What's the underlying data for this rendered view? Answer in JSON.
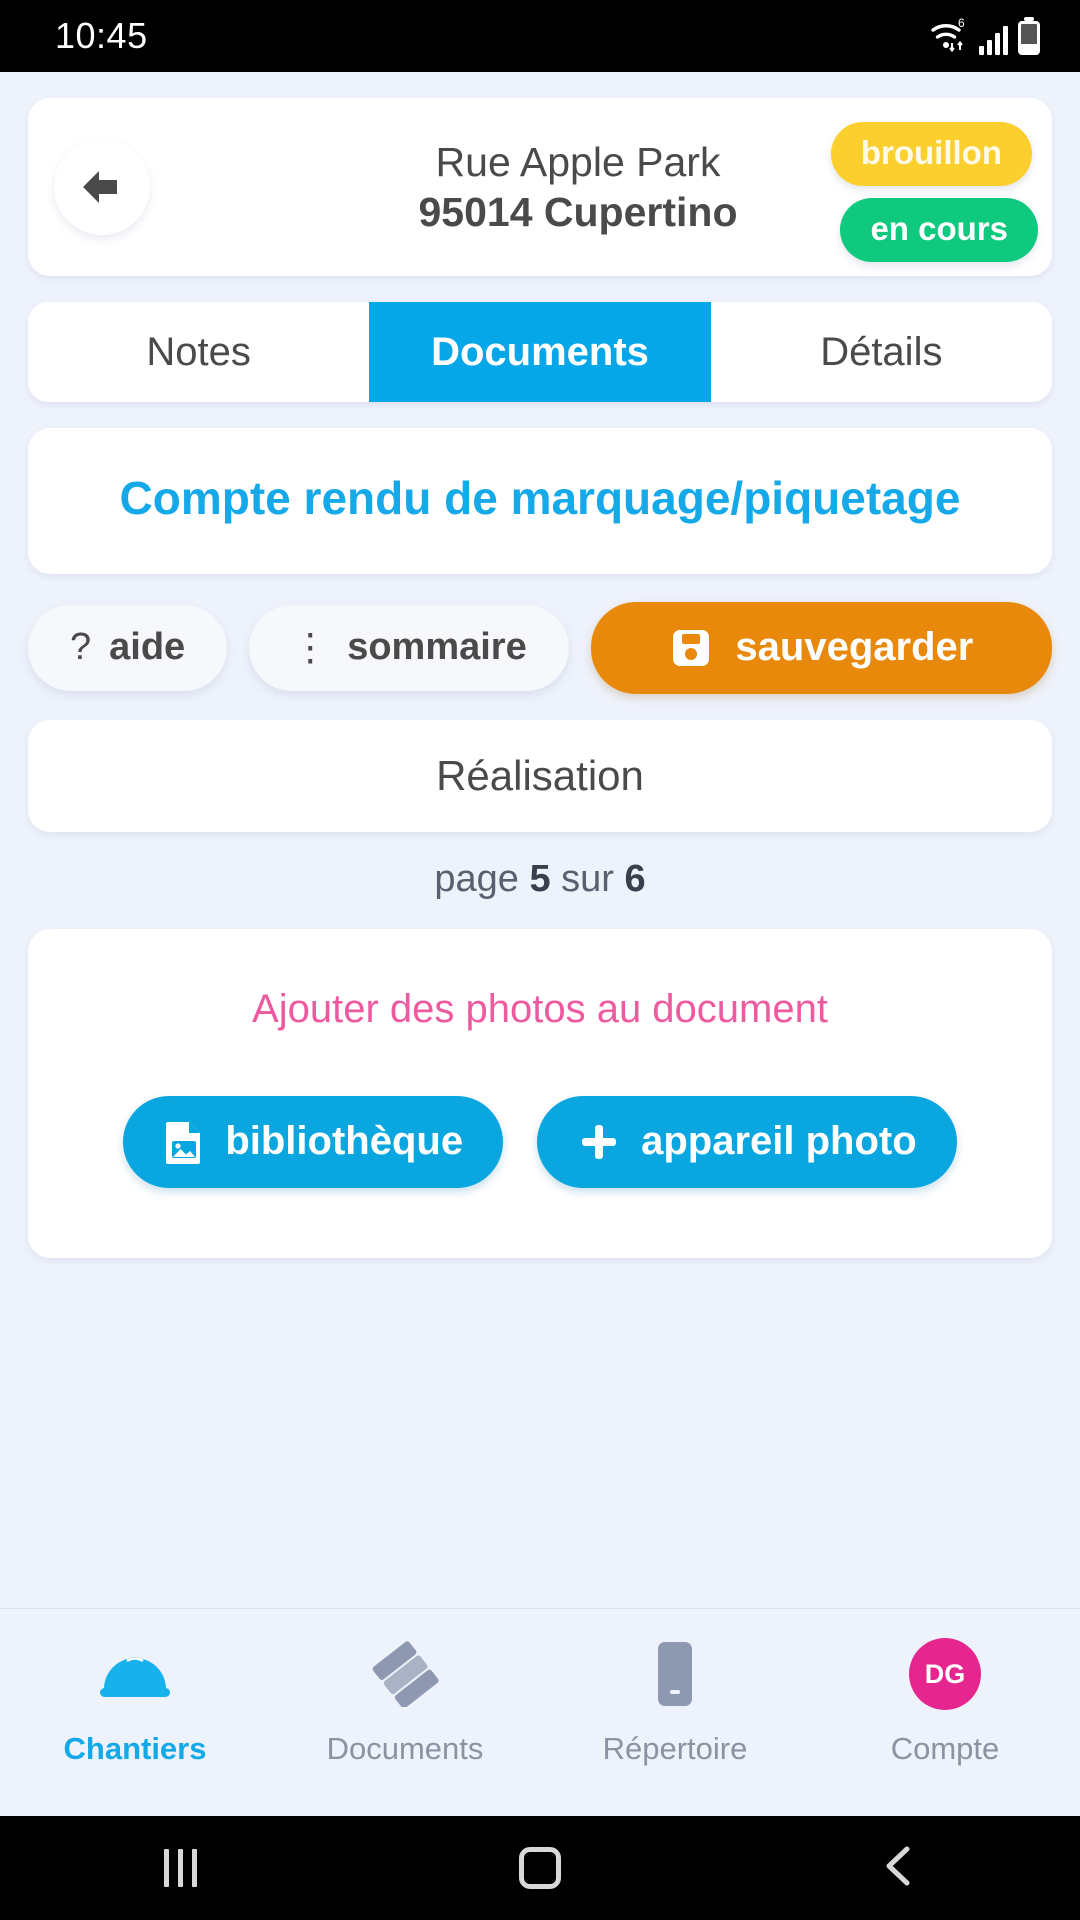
{
  "statusbar": {
    "time": "10:45",
    "wifi_generation": "6",
    "icons": [
      "wifi-icon",
      "cellular-signal-icon",
      "battery-icon"
    ]
  },
  "header": {
    "back_icon": "arrow-left-icon",
    "address_line1": "Rue Apple Park",
    "address_line2": "95014 Cupertino",
    "badges": [
      {
        "label": "brouillon",
        "color": "#facf2e"
      },
      {
        "label": "en cours",
        "color": "#0fc97e"
      }
    ]
  },
  "tabs": [
    {
      "label": "Notes",
      "active": false
    },
    {
      "label": "Documents",
      "active": true
    },
    {
      "label": "Détails",
      "active": false
    }
  ],
  "document": {
    "title": "Compte rendu de marquage/piquetage",
    "title_color": "#16a9ea"
  },
  "actions": {
    "help_icon": "question-mark-icon",
    "help_label": "aide",
    "summary_icon": "vertical-dots-icon",
    "summary_label": "sommaire",
    "save_icon": "floppy-disk-icon",
    "save_label": "sauvegarder",
    "save_color": "#e8890c"
  },
  "section": {
    "title": "Réalisation"
  },
  "pagination": {
    "prefix": "page",
    "current": "5",
    "middle": "sur",
    "total": "6"
  },
  "photos": {
    "title": "Ajouter des photos au document",
    "title_color": "#ee5aa0",
    "library_icon": "image-file-icon",
    "library_label": "bibliothèque",
    "camera_icon": "plus-icon",
    "camera_label": "appareil photo",
    "button_color": "#0aa6e0"
  },
  "bottom_nav": [
    {
      "label": "Chantiers",
      "icon": "hard-hat-icon",
      "active": true
    },
    {
      "label": "Documents",
      "icon": "documents-icon",
      "active": false
    },
    {
      "label": "Répertoire",
      "icon": "phone-icon",
      "active": false
    },
    {
      "label": "Compte",
      "icon": "avatar-icon",
      "avatar_initials": "DG",
      "active": false
    }
  ],
  "android_nav": {
    "recents_icon": "recents-icon",
    "home_icon": "home-icon",
    "back_icon": "back-chevron-icon"
  }
}
